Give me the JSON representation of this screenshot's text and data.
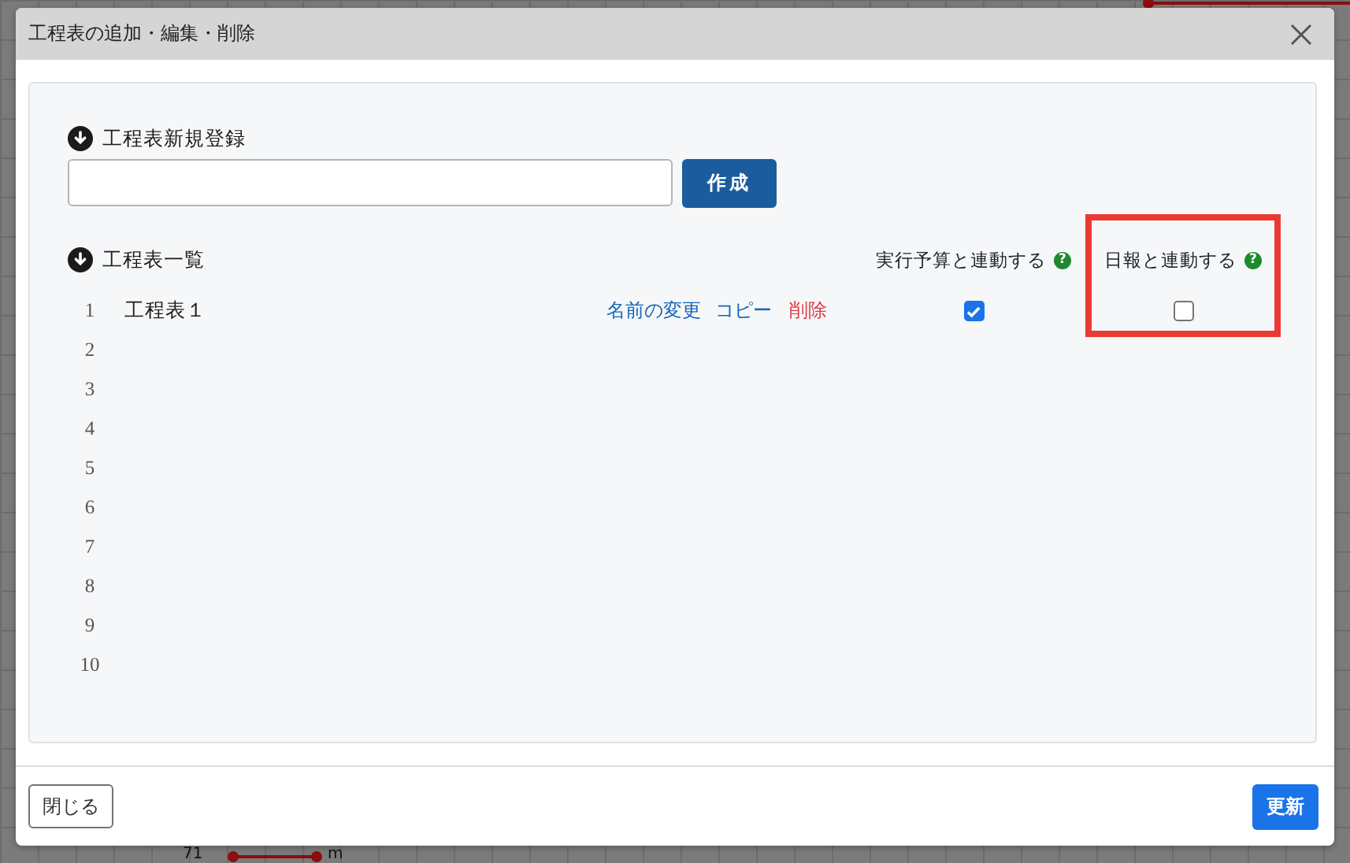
{
  "background": {
    "labels": [
      {
        "text": "71"
      },
      {
        "text": "m"
      }
    ]
  },
  "window": {
    "title": "工程表の追加・編集・削除"
  },
  "new_schedule": {
    "label": "工程表新規登録",
    "create_button": "作成"
  },
  "list": {
    "label": "工程表一覧",
    "columns": [
      {
        "label": "実行予算と連動する",
        "help": "?"
      },
      {
        "label": "日報と連動する",
        "help": "?",
        "highlighted": true
      }
    ],
    "rows": [
      {
        "number": "1",
        "name": "工程表１",
        "actions": [
          {
            "label": "名前の変更",
            "kind": "link"
          },
          {
            "label": "コピー",
            "kind": "link"
          },
          {
            "label": "削除",
            "kind": "danger"
          }
        ],
        "budget_linked": true,
        "report_linked": false
      },
      {
        "number": "2"
      },
      {
        "number": "3"
      },
      {
        "number": "4"
      },
      {
        "number": "5"
      },
      {
        "number": "6"
      },
      {
        "number": "7"
      },
      {
        "number": "8"
      },
      {
        "number": "9"
      },
      {
        "number": "10"
      }
    ]
  },
  "footer": {
    "close_button": "閉じる",
    "update_button": "更新"
  }
}
